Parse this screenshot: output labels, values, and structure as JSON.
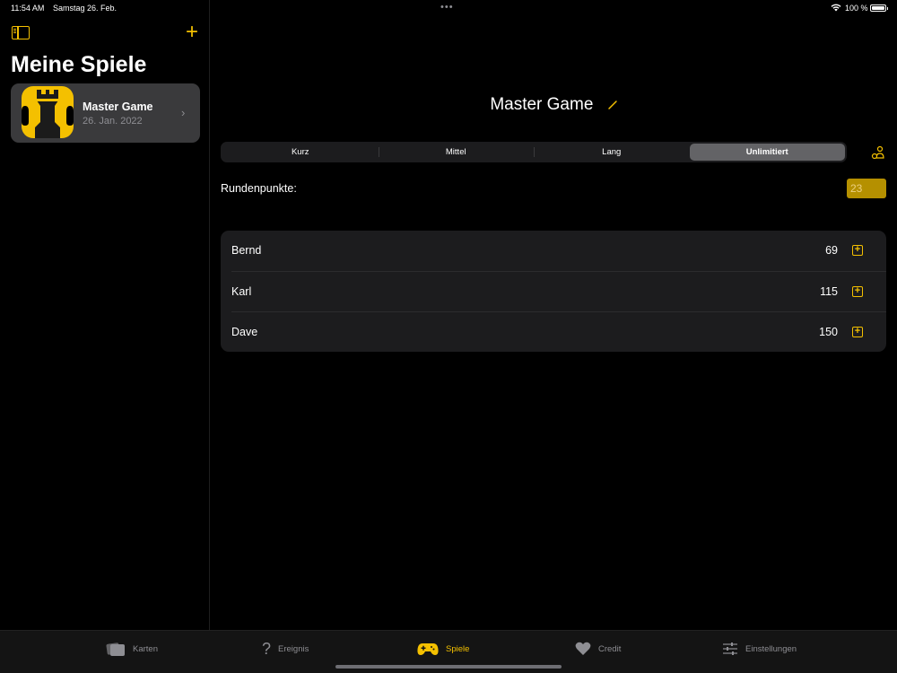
{
  "status_bar": {
    "time": "11:54 AM",
    "date": "Samstag 26. Feb.",
    "battery": "100 %"
  },
  "sidebar": {
    "title": "Meine Spiele",
    "games": [
      {
        "name": "Master Game",
        "date": "26. Jan. 2022"
      }
    ]
  },
  "main": {
    "title": "Master Game",
    "modes": [
      "Kurz",
      "Mittel",
      "Lang",
      "Unlimitiert"
    ],
    "selected_mode": "Unlimitiert",
    "round_points_label": "Rundenpunkte:",
    "round_points_value": "23",
    "players": [
      {
        "name": "Bernd",
        "score": "69"
      },
      {
        "name": "Karl",
        "score": "115"
      },
      {
        "name": "Dave",
        "score": "150"
      }
    ]
  },
  "tabbar": {
    "items": [
      {
        "label": "Karten",
        "icon": "cards-icon"
      },
      {
        "label": "Ereignis",
        "icon": "question-icon"
      },
      {
        "label": "Spiele",
        "icon": "gamepad-icon"
      },
      {
        "label": "Credit",
        "icon": "heart-icon"
      },
      {
        "label": "Einstellungen",
        "icon": "sliders-icon"
      }
    ],
    "active": "Spiele"
  },
  "colors": {
    "accent": "#f4c000",
    "background": "#000000",
    "card": "#1c1c1e",
    "selected_card": "#3a3a3c"
  }
}
